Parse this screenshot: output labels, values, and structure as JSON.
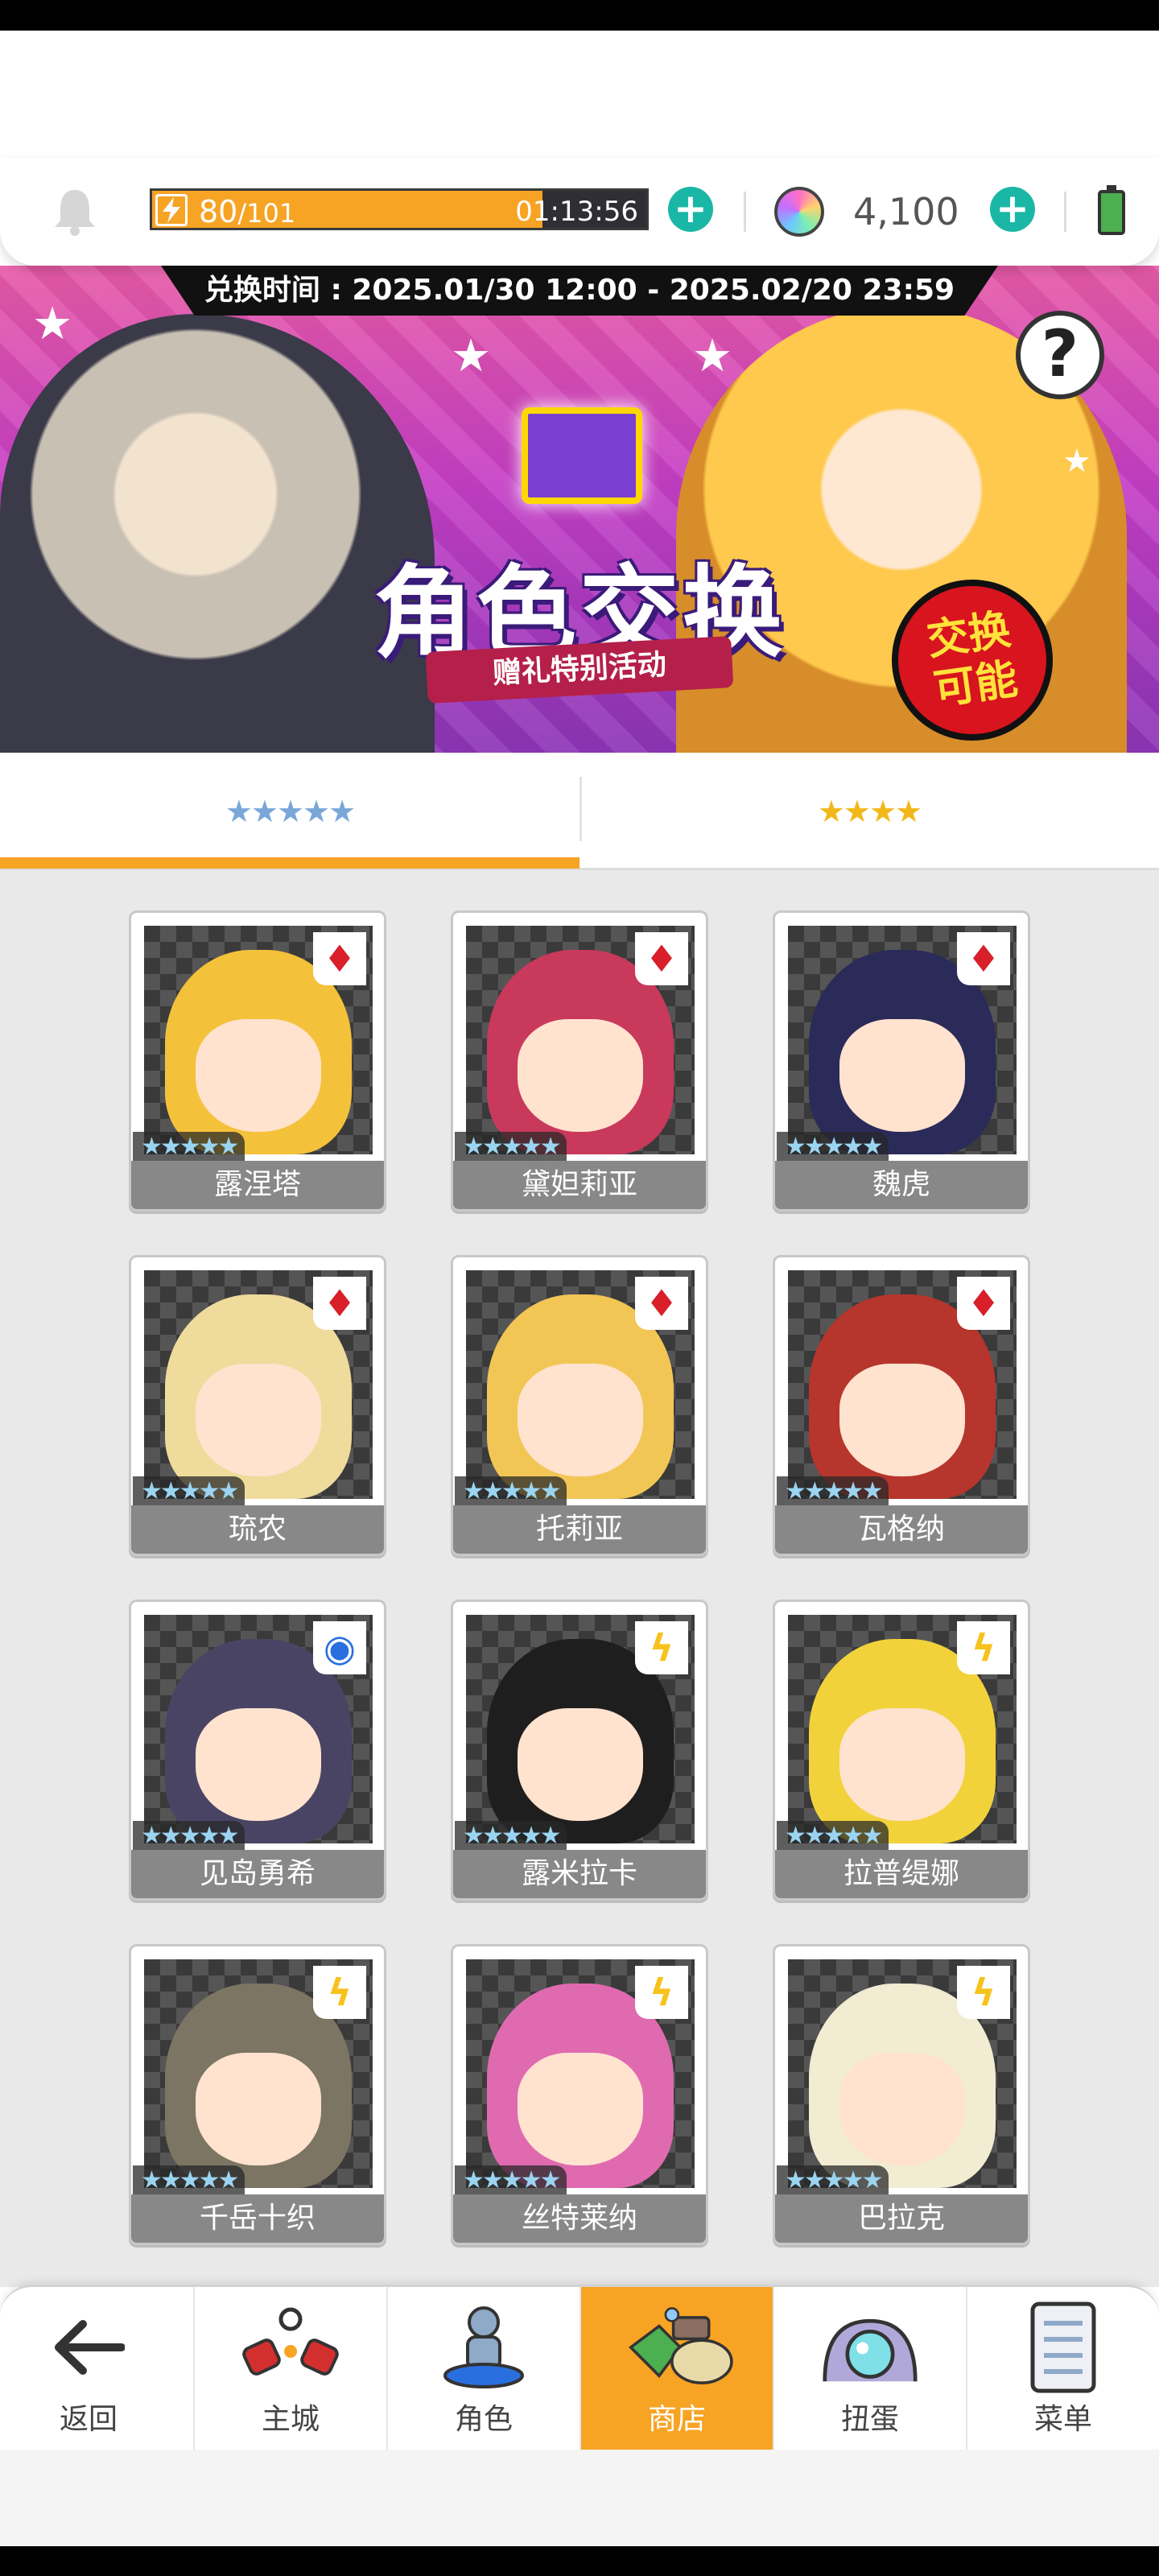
{
  "top_bar": {
    "stamina_current": "80",
    "stamina_max": "/101",
    "stamina_fraction": 0.79,
    "stamina_timer": "01:13:56",
    "gems": "4,100",
    "plus_label": "+"
  },
  "banner": {
    "period": "兑换时间 : 2025.01/30 12:00 - 2025.02/20 23:59",
    "title": "角色交换",
    "subtitle": "赠礼特别活动",
    "badge_line1": "交换",
    "badge_line2": "可能",
    "help_label": "?"
  },
  "tabs": [
    {
      "label": "★★★★★",
      "selected": true
    },
    {
      "label": "★★★★",
      "selected": false
    }
  ],
  "characters": [
    {
      "name": "露涅塔",
      "stars": "★★★★★",
      "type": "fire",
      "type_glyph": "♦",
      "face_color": "#f4c23a"
    },
    {
      "name": "黛妲莉亚",
      "stars": "★★★★★",
      "type": "fire",
      "type_glyph": "♦",
      "face_color": "#c9395b"
    },
    {
      "name": "魏虎",
      "stars": "★★★★★",
      "type": "fire",
      "type_glyph": "♦",
      "face_color": "#2b2b5a"
    },
    {
      "name": "琉农",
      "stars": "★★★★★",
      "type": "fire",
      "type_glyph": "♦",
      "face_color": "#efdb9c"
    },
    {
      "name": "托莉亚",
      "stars": "★★★★★",
      "type": "fire",
      "type_glyph": "♦",
      "face_color": "#f2c655"
    },
    {
      "name": "瓦格纳",
      "stars": "★★★★★",
      "type": "fire",
      "type_glyph": "♦",
      "face_color": "#b6352c"
    },
    {
      "name": "见岛勇希",
      "stars": "★★★★★",
      "type": "water",
      "type_glyph": "◉",
      "face_color": "#4a4464"
    },
    {
      "name": "露米拉卡",
      "stars": "★★★★★",
      "type": "thunder",
      "type_glyph": "ϟ",
      "face_color": "#1e1e1e"
    },
    {
      "name": "拉普缇娜",
      "stars": "★★★★★",
      "type": "thunder",
      "type_glyph": "ϟ",
      "face_color": "#f2d23a"
    },
    {
      "name": "千岳十织",
      "stars": "★★★★★",
      "type": "thunder",
      "type_glyph": "ϟ",
      "face_color": "#7d7563"
    },
    {
      "name": "丝特莱纳",
      "stars": "★★★★★",
      "type": "thunder",
      "type_glyph": "ϟ",
      "face_color": "#e06ab0"
    },
    {
      "name": "巴拉克",
      "stars": "★★★★★",
      "type": "thunder",
      "type_glyph": "ϟ",
      "face_color": "#f1ecd2"
    }
  ],
  "nav": {
    "back": "返回",
    "items": [
      {
        "label": "主城",
        "icon": "town-icon"
      },
      {
        "label": "角色",
        "icon": "character-icon"
      },
      {
        "label": "商店",
        "icon": "shop-icon",
        "active": true
      },
      {
        "label": "扭蛋",
        "icon": "gacha-icon"
      },
      {
        "label": "菜单",
        "icon": "menu-icon"
      }
    ]
  },
  "colors": {
    "accent": "#f7a324",
    "teal": "#1bb7a6",
    "fire": "#d81f2a",
    "thunder": "#f7c21b",
    "water": "#2a6fe0"
  }
}
